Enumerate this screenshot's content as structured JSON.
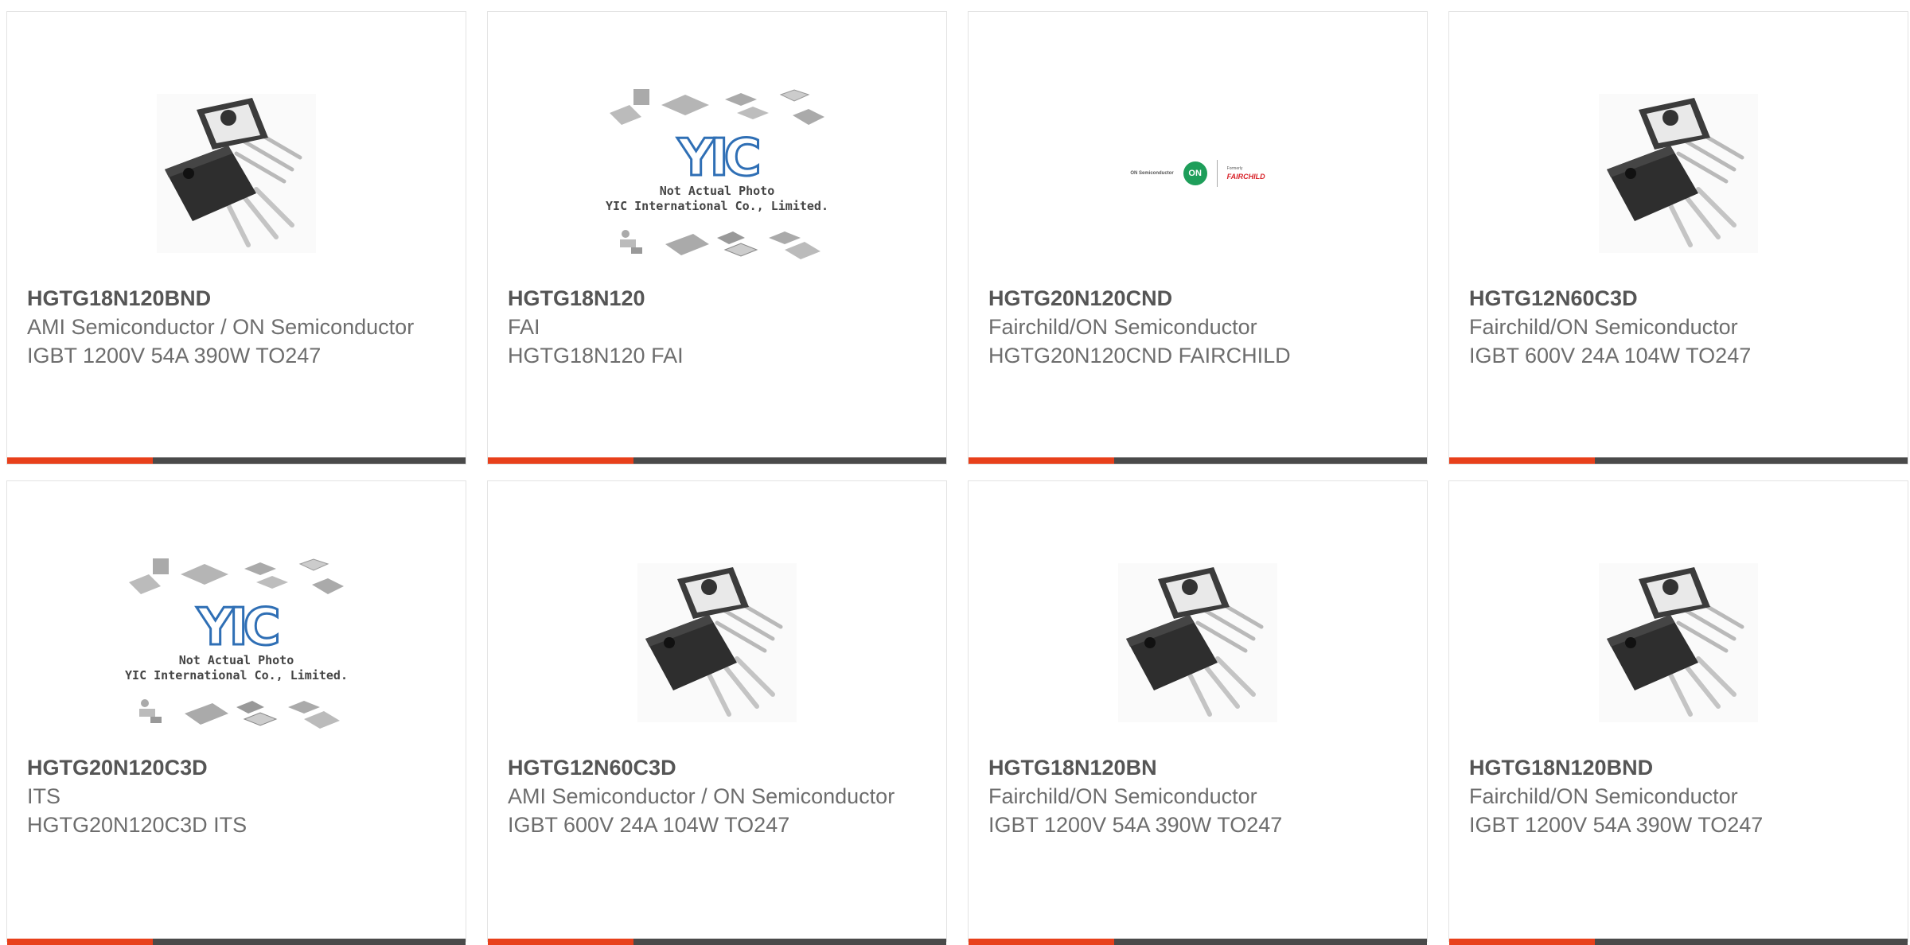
{
  "cards": [
    {
      "part_number": "HGTG18N120BND",
      "manufacturer": "AMI Semiconductor / ON Semiconductor",
      "description": "IGBT 1200V 54A 390W TO247",
      "image": "to247-transistor-photo"
    },
    {
      "part_number": "HGTG18N120",
      "manufacturer": "FAI",
      "description": "HGTG18N120 FAI",
      "image": "yic-placeholder",
      "image_caption_1": "Not Actual Photo",
      "image_caption_2": "YIC International Co., Limited.",
      "image_logo": "YIC"
    },
    {
      "part_number": "HGTG20N120CND",
      "manufacturer": "Fairchild/ON Semiconductor",
      "description": "HGTG20N120CND FAIRCHILD",
      "image": "on-fairchild-logo",
      "logo_left": "ON Semiconductor",
      "logo_circle": "ON",
      "logo_formerly": "Formerly",
      "logo_fairchild": "FAIRCHILD"
    },
    {
      "part_number": "HGTG12N60C3D",
      "manufacturer": "Fairchild/ON Semiconductor",
      "description": "IGBT 600V 24A 104W TO247",
      "image": "to247-transistor-photo"
    },
    {
      "part_number": "HGTG20N120C3D",
      "manufacturer": "ITS",
      "description": "HGTG20N120C3D ITS",
      "image": "yic-placeholder",
      "image_caption_1": "Not Actual Photo",
      "image_caption_2": "YIC International Co., Limited.",
      "image_logo": "YIC"
    },
    {
      "part_number": "HGTG12N60C3D",
      "manufacturer": "AMI Semiconductor / ON Semiconductor",
      "description": "IGBT 600V 24A 104W TO247",
      "image": "to247-transistor-photo"
    },
    {
      "part_number": "HGTG18N120BN",
      "manufacturer": "Fairchild/ON Semiconductor",
      "description": "IGBT 1200V 54A 390W TO247",
      "image": "to247-transistor-photo"
    },
    {
      "part_number": "HGTG18N120BND",
      "manufacturer": "Fairchild/ON Semiconductor",
      "description": "IGBT 1200V 54A 390W TO247",
      "image": "to247-transistor-photo"
    }
  ],
  "colors": {
    "accent": "#e8401b",
    "bar": "#4a4a4a"
  }
}
